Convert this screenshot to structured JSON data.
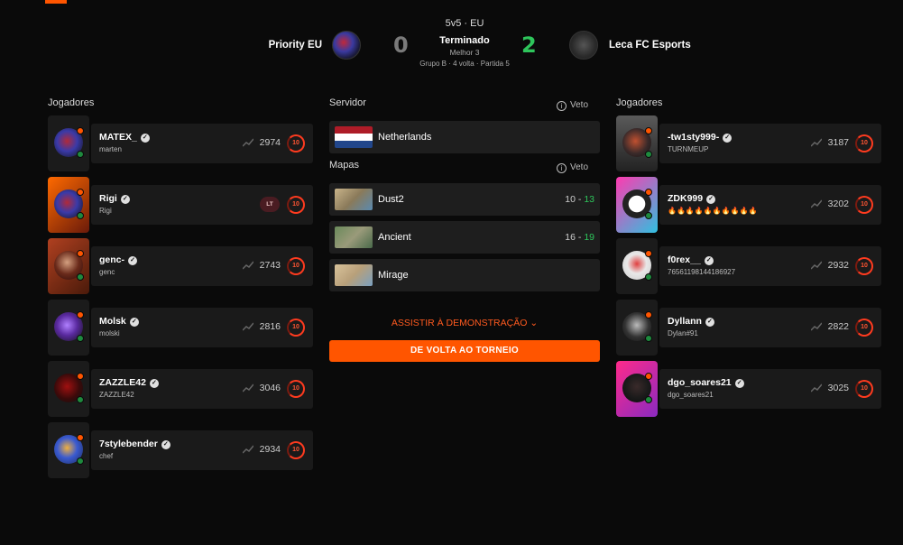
{
  "match": {
    "mode": "5v5 · EU",
    "status": "Terminado",
    "best_of": "Melhor 3",
    "group_info": "Grupo B · 4 volta · Partida 5",
    "team_left": {
      "name": "Priority EU",
      "score": "0",
      "logo_icon": "team-priority-logo"
    },
    "team_right": {
      "name": "Leca FC Esports",
      "score": "2",
      "logo_icon": "team-leca-logo"
    },
    "colors": {
      "accent": "#ff5500",
      "win_green": "#2ec55b",
      "lose_gray": "#7a7a7a"
    }
  },
  "labels": {
    "players_left": "Jogadores",
    "players_right": "Jogadores",
    "server": "Servidor",
    "maps": "Mapas",
    "veto": "Veto",
    "watch_demo": "ASSISTIR À DEMONSTRAÇÃO",
    "back_to_tournament": "DE VOLTA AO TORNEIO"
  },
  "server": {
    "name": "Netherlands",
    "flag_icon": "netherlands-flag"
  },
  "maps": [
    {
      "name": "Dust2",
      "score_left": "10",
      "score_right": "13"
    },
    {
      "name": "Ancient",
      "score_left": "16",
      "score_right": "19"
    },
    {
      "name": "Mirage",
      "score_left": "",
      "score_right": ""
    }
  ],
  "players_left": [
    {
      "name": "MATEX_",
      "sub": "marten",
      "elo": "2974",
      "level": "10"
    },
    {
      "name": "Rigi",
      "sub": "Rigi",
      "elo": "",
      "level": "10",
      "badge": "LT"
    },
    {
      "name": "genc-",
      "sub": "genc",
      "elo": "2743",
      "level": "10"
    },
    {
      "name": "Molsk",
      "sub": "molski",
      "elo": "2816",
      "level": "10"
    },
    {
      "name": "ZAZZLE42",
      "sub": "ZAZZLE42",
      "elo": "3046",
      "level": "10"
    },
    {
      "name": "7stylebender",
      "sub": "chef",
      "elo": "2934",
      "level": "10"
    }
  ],
  "players_right": [
    {
      "name": "-tw1sty999-",
      "sub": "TURNMEUP",
      "elo": "3187",
      "level": "10"
    },
    {
      "name": "ZDK999",
      "sub": "🔥🔥🔥🔥🔥🔥🔥🔥🔥🔥",
      "elo": "3202",
      "level": "10"
    },
    {
      "name": "f0rex__",
      "sub": "76561198144186927",
      "elo": "2932",
      "level": "10"
    },
    {
      "name": "Dyllann",
      "sub": "Dylan#91",
      "elo": "2822",
      "level": "10"
    },
    {
      "name": "dgo_soares21",
      "sub": "dgo_soares21",
      "elo": "3025",
      "level": "10"
    }
  ]
}
